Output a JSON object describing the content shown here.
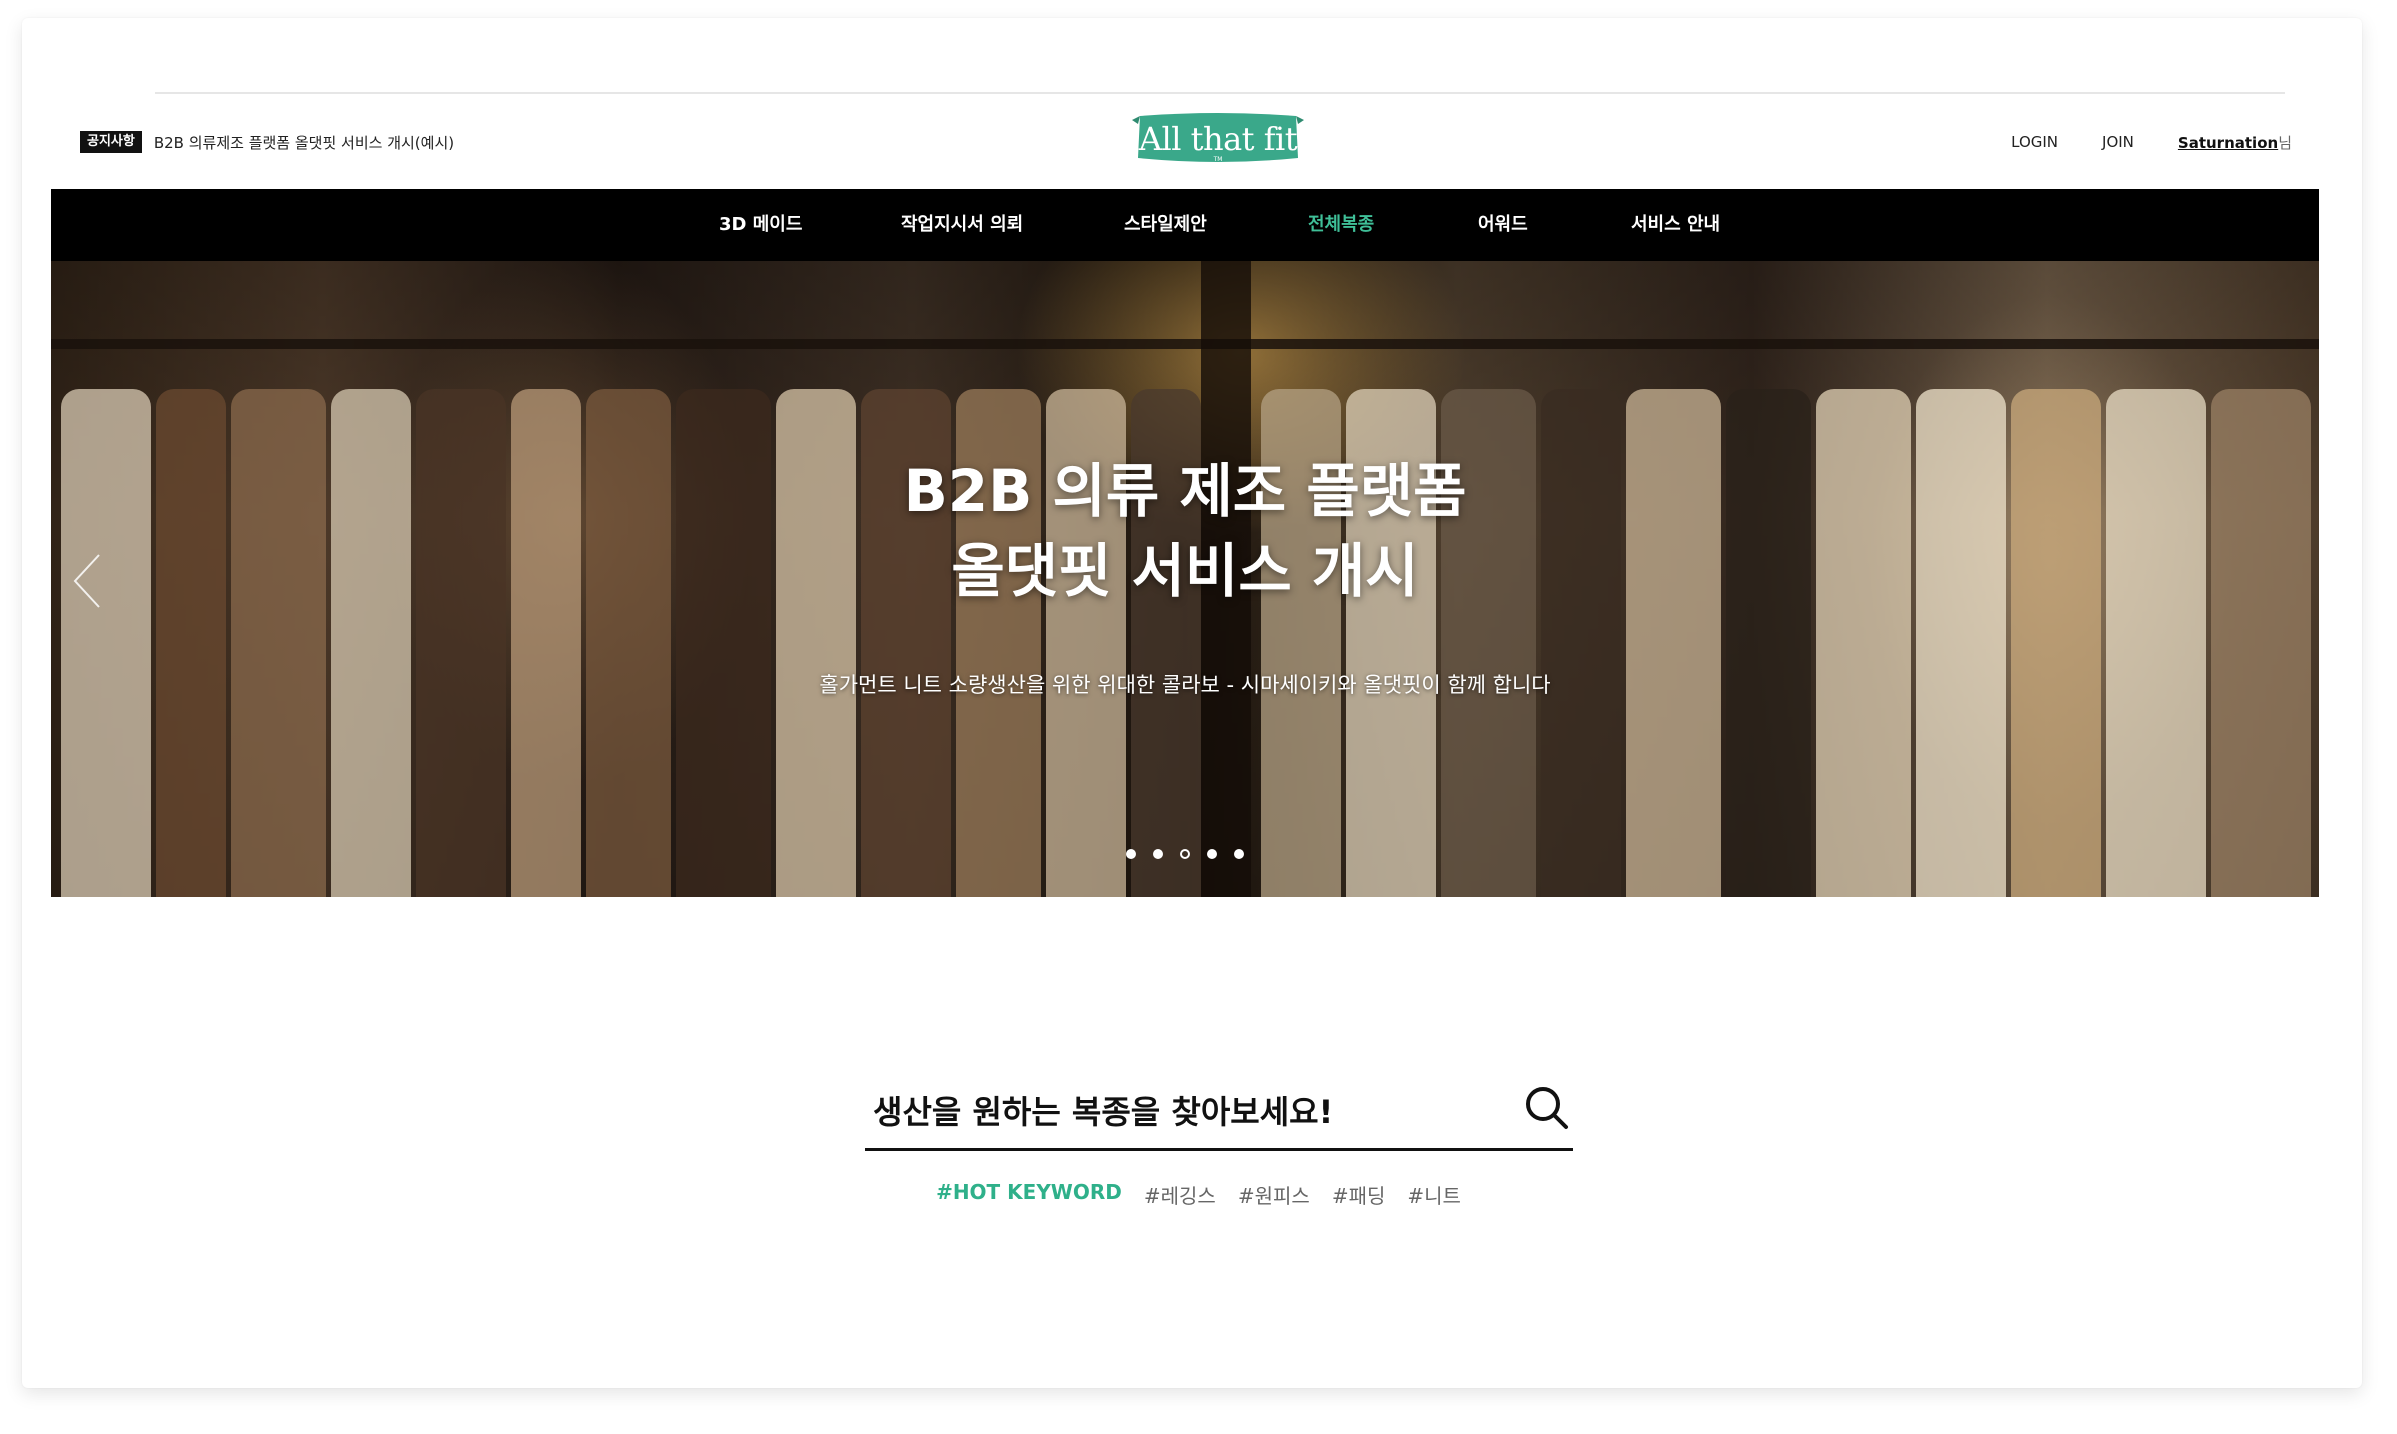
{
  "header": {
    "notice_badge": "공지사항",
    "notice_text": "B2B 의류제조 플랫폼 올댓핏 서비스 개시(예시)",
    "logo_text": "All that fit",
    "logo_tm": "TM",
    "login": "LOGIN",
    "join": "JOIN",
    "user_name": "Saturnation",
    "user_suffix": "님"
  },
  "nav": {
    "items": [
      {
        "label": "3D 메이드"
      },
      {
        "label": "작업지시서 의뢰"
      },
      {
        "label": "스타일제안"
      },
      {
        "label": "전체복종"
      },
      {
        "label": "어워드"
      },
      {
        "label": "서비스 안내"
      }
    ],
    "active_index": 3,
    "active_color": "#3fbf98"
  },
  "hero": {
    "title_line1": "B2B 의류 제조 플랫폼",
    "title_line2": "올댓핏 서비스 개시",
    "subtitle": "홀가먼트 니트 소량생산을 위한 위대한 콜라보 - 시마세이키와 올댓핏이 함께 합니다",
    "slides": 5,
    "active_slide": 3
  },
  "search": {
    "placeholder": "생산을 원하는 복종을 찾아보세요!",
    "hot_label": "#HOT KEYWORD",
    "keywords": [
      "#레깅스",
      "#원피스",
      "#패딩",
      "#니트"
    ]
  },
  "colors": {
    "brand": "#3aa88a",
    "nav_bg": "#000000",
    "keyword_accent": "#2fb08a"
  }
}
